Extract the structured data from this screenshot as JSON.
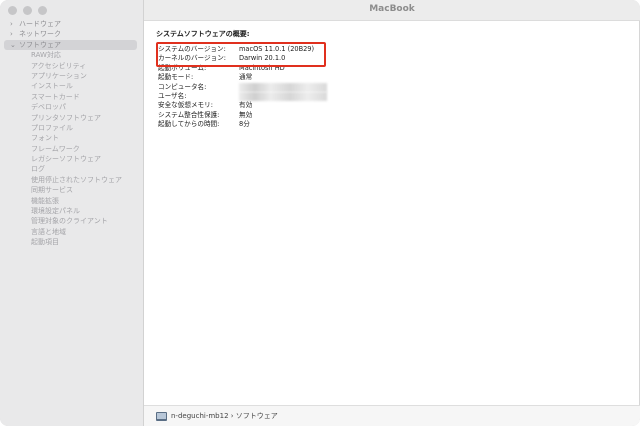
{
  "window": {
    "title": "MacBook"
  },
  "sidebar": {
    "top_items": [
      {
        "label": "ハードウェア",
        "chevron": "›"
      },
      {
        "label": "ネットワーク",
        "chevron": "›"
      },
      {
        "label": "ソフトウェア",
        "chevron": "⌄"
      }
    ],
    "software_children": [
      "RAW対応",
      "アクセシビリティ",
      "アプリケーション",
      "インストール",
      "スマートカード",
      "デベロッパ",
      "プリンタソフトウェア",
      "プロファイル",
      "フォント",
      "フレームワーク",
      "レガシーソフトウェア",
      "ログ",
      "使用停止されたソフトウェア",
      "同期サービス",
      "機能拡張",
      "環境設定パネル",
      "管理対象のクライアント",
      "言語と地域",
      "起動項目"
    ]
  },
  "content": {
    "heading": "システムソフトウェアの概要:",
    "rows": [
      {
        "key": "システムのバージョン:",
        "value": "macOS 11.0.1 (20B29)"
      },
      {
        "key": "カーネルのバージョン:",
        "value": "Darwin 20.1.0"
      },
      {
        "key": "起動ボリューム:",
        "value": "Macintosh HD"
      },
      {
        "key": "起動モード:",
        "value": "通常"
      },
      {
        "key": "コンピュータ名:",
        "value": ""
      },
      {
        "key": "ユーザ名:",
        "value": ""
      },
      {
        "key": "安全な仮想メモリ:",
        "value": "有効"
      },
      {
        "key": "システム整合性保護:",
        "value": "無効"
      },
      {
        "key": "起動してからの時間:",
        "value": "8分"
      }
    ]
  },
  "statusbar": {
    "breadcrumb": "n-deguchi-mb12 › ソフトウェア"
  },
  "colors": {
    "highlight": "#e0301e",
    "sidebar_bg": "#e9e9ea"
  }
}
